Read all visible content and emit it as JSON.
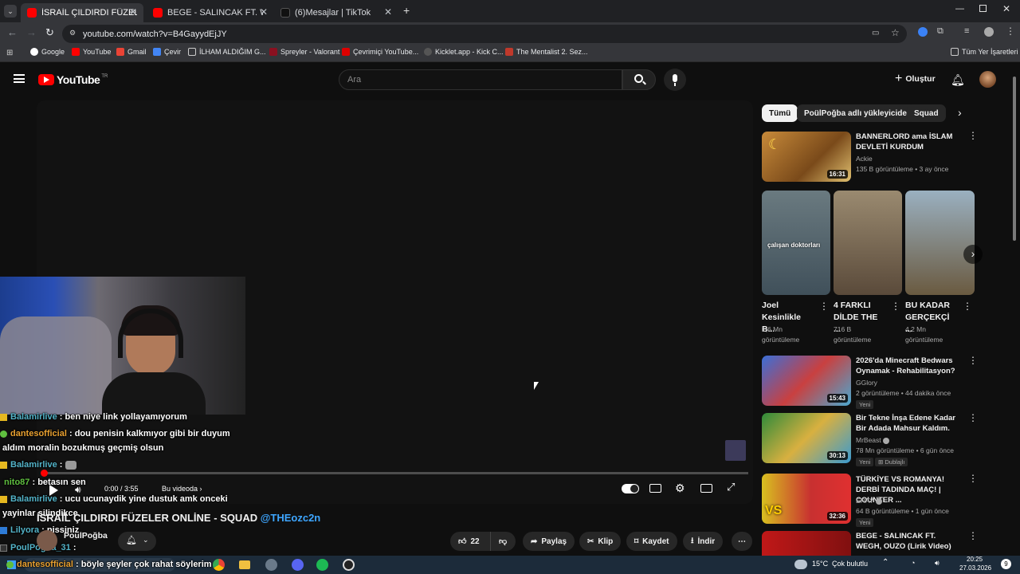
{
  "browser": {
    "tabs": [
      {
        "title": "İSRAİL ÇILDIRDI FÜZELER ONLİ",
        "active": true
      },
      {
        "title": "BEGE - SALINCAK FT. WEGH, O",
        "active": false
      },
      {
        "title": "(6)Mesajlar | TikTok",
        "active": false
      }
    ],
    "url": "youtube.com/watch?v=B4GayydEjJY",
    "bookmarks": [
      "Google",
      "YouTube",
      "Gmail",
      "Çevir",
      "İLHAM ALDIĞIM G...",
      "Spreyler - Valorant",
      "Çevrimiçi YouTube...",
      "Kicklet.app - Kick C...",
      "The Mentalist 2. Sez..."
    ],
    "all_bookmarks": "Tüm Yer İşaretleri"
  },
  "youtube": {
    "logo": "YouTube",
    "logo_country": "TR",
    "search_placeholder": "Ara",
    "create_label": "Oluştur"
  },
  "player": {
    "time": "0:00 / 3:55",
    "chapter": "Bu videoda",
    "progress": 0.0
  },
  "video": {
    "title": "İSRAİL ÇILDIRDI FÜZELER ONLİNE - SQUAD",
    "mention": "@THEozc2n",
    "channel": "PoulPoğba",
    "likes": "22",
    "actions": {
      "share": "Paylaş",
      "clip": "Klip",
      "save": "Kaydet",
      "download": "İndir"
    }
  },
  "chat": [
    {
      "user": "Balamirlive",
      "text": ": ben niye link yollayamıyorum"
    },
    {
      "user": "dantesofficial",
      "text": ": dou penisin kalkmıyor gibi bir duyum"
    },
    {
      "user": "",
      "text": "aldım moralin bozukmuş geçmiş olsun"
    },
    {
      "user": "Balamirlive",
      "text": ":"
    },
    {
      "user": "nito87",
      "text": ": betasın sen"
    },
    {
      "user": "Balamirlive",
      "text": ": ucu ucunaydik yine dustuk amk onceki"
    },
    {
      "user": "",
      "text": "yayinlar silindikce"
    },
    {
      "user": "Lilyora",
      "text": ": pissiniz"
    },
    {
      "user": "PoulPogba_31",
      "text": ":"
    },
    {
      "user": "dantesofficial",
      "text": ": böyle şeyler çok rahat söylerim"
    }
  ],
  "sidebar": {
    "chips": [
      "Tümü",
      "PoülPoğba adlı yükleyiciden",
      "Squad"
    ],
    "top_video": {
      "title": "BANNERLORD ama İSLAM DEVLETİ KURDUM",
      "channel": "Ackie",
      "meta": "135 B görüntüleme • 3 ay önce",
      "duration": "16:31"
    },
    "shorts": [
      {
        "title": "Joel Kesinlikle B...",
        "views": "1,6 Mn",
        "unit": "görüntüleme",
        "thumb_text": "çalışan doktorları"
      },
      {
        "title": "4 FARKLI DİLDE THE ...",
        "views": "716 B",
        "unit": "görüntüleme"
      },
      {
        "title": "BU KADAR GERÇEKÇİ ...",
        "views": "4,2 Mn",
        "unit": "görüntüleme"
      }
    ],
    "videos": [
      {
        "title": "2026'da Minecraft Bedwars Oynamak - Rehabilitasyon?",
        "channel": "GGlory",
        "meta": "2 görüntüleme • 44 dakika önce",
        "duration": "15:43",
        "badge": "Yeni"
      },
      {
        "title": "Bir Tekne İnşa Edene Kadar Bir Adada Mahsur Kaldım.",
        "channel": "MrBeast",
        "meta": "78 Mn görüntüleme • 6 gün önce",
        "duration": "30:13",
        "badge": "Yeni",
        "badge2": "Dublajlı"
      },
      {
        "title": "TÜRKİYE VS ROMANYA! DERBİ TADINDA MAÇ! | COUNTER ...",
        "channel": "ERAY",
        "meta": "64 B görüntüleme • 1 gün önce",
        "duration": "32:36",
        "badge": "Yeni"
      },
      {
        "title": "BEGE - SALINCAK FT. WEGH, OUZO (Lirik Video)",
        "channel": "",
        "meta": "",
        "duration": ""
      }
    ]
  },
  "taskbar": {
    "weather": "15°C",
    "weather_text": "Çok bulutlu",
    "time": "20:25",
    "date": "27.03.2026",
    "notif": "9"
  }
}
